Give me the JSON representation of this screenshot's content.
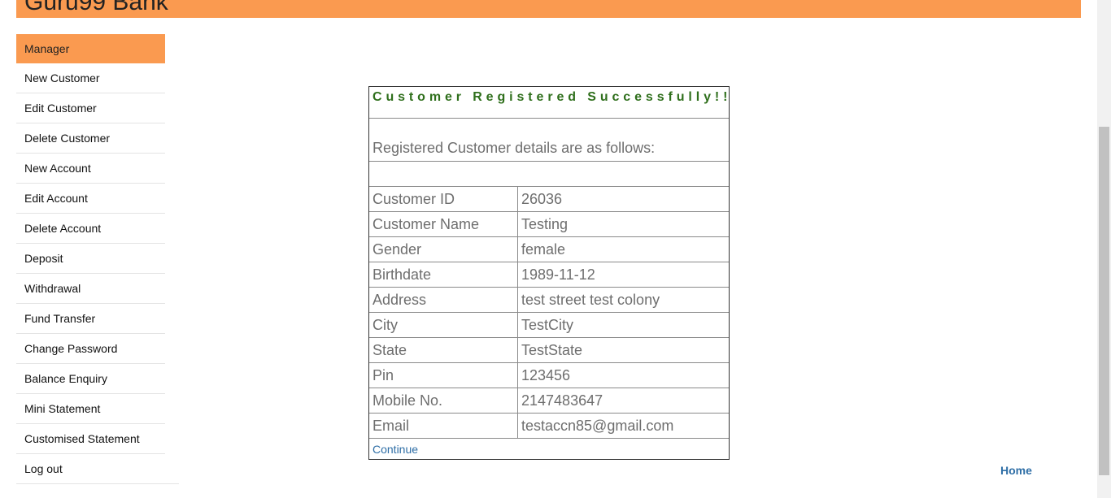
{
  "banner": {
    "title": "Guru99 Bank"
  },
  "menu": {
    "header": "Manager",
    "items": [
      "New Customer",
      "Edit Customer",
      "Delete Customer",
      "New Account",
      "Edit Account",
      "Delete Account",
      "Deposit",
      "Withdrawal",
      "Fund Transfer",
      "Change Password",
      "Balance Enquiry",
      "Mini Statement",
      "Customised Statement",
      "Log out"
    ]
  },
  "result": {
    "heading": "Customer Registered Successfully!!!",
    "subheading": "Registered Customer details are as follows:",
    "rows": [
      {
        "label": "Customer ID",
        "value": "26036"
      },
      {
        "label": "Customer Name",
        "value": "Testing"
      },
      {
        "label": "Gender",
        "value": "female"
      },
      {
        "label": "Birthdate",
        "value": "1989-11-12"
      },
      {
        "label": "Address",
        "value": "test street test colony"
      },
      {
        "label": "City",
        "value": "TestCity"
      },
      {
        "label": "State",
        "value": "TestState"
      },
      {
        "label": "Pin",
        "value": "123456"
      },
      {
        "label": "Mobile No.",
        "value": "2147483647"
      },
      {
        "label": "Email",
        "value": "testaccn85@gmail.com"
      }
    ],
    "continue_label": "Continue"
  },
  "footer": {
    "home_label": "Home"
  },
  "colors": {
    "accent": "#fa9a50",
    "success_text": "#2f6f1c",
    "link": "#2e6ea6"
  }
}
